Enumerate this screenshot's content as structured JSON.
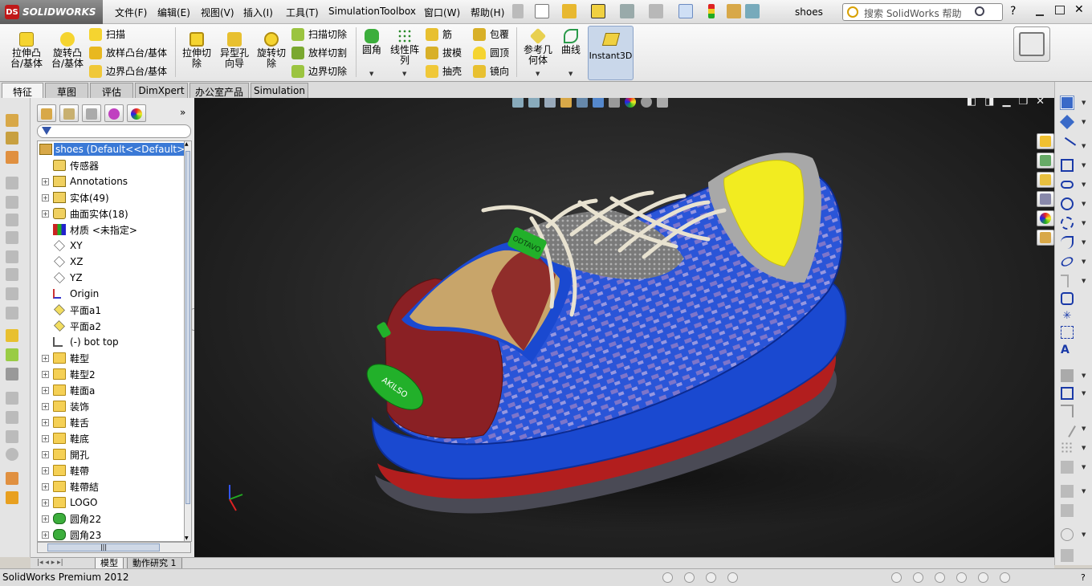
{
  "app": {
    "brand": "SOLIDWORKS",
    "filename": "shoes",
    "help_placeholder": "搜索 SolidWorks 帮助",
    "help_question": "?"
  },
  "menu": [
    "文件(F)",
    "编辑(E)",
    "视图(V)",
    "插入(I)",
    "工具(T)",
    "Simulation",
    "Toolbox",
    "窗口(W)",
    "帮助(H)"
  ],
  "commands": {
    "extrude_boss": "拉伸凸\n台/基体",
    "revolve_boss": "旋转凸\n台/基体",
    "sweep": "扫描",
    "loft_boss": "放样凸台/基体",
    "boundary_boss": "边界凸台/基体",
    "extrude_cut": "拉伸切\n除",
    "hole_wizard": "异型孔\n向导",
    "revolve_cut": "旋转切\n除",
    "sweep_cut": "扫描切除",
    "loft_cut": "放样切割",
    "boundary_cut": "边界切除",
    "fillet": "圆角",
    "linear_pattern": "线性阵\n列",
    "rib": "筋",
    "draft": "拔模",
    "shell": "抽壳",
    "wrap": "包覆",
    "dome": "圆顶",
    "mirror": "镜向",
    "ref_geometry": "参考几\n何体",
    "curves": "曲线",
    "instant3d": "Instant3D"
  },
  "tabs": [
    "特征",
    "草图",
    "评估",
    "DimXpert",
    "办公室产品",
    "Simulation"
  ],
  "tree": [
    {
      "label": "shoes  (Default<<Default>",
      "icon": "part-icon",
      "expand": false,
      "selected": true
    },
    {
      "label": "传感器",
      "icon": "sensor-icon",
      "expand": false
    },
    {
      "label": "Annotations",
      "icon": "annotations-icon",
      "expand": true
    },
    {
      "label": "实体(49)",
      "icon": "solid-bodies-icon",
      "expand": true
    },
    {
      "label": "曲面实体(18)",
      "icon": "surface-bodies-icon",
      "expand": true
    },
    {
      "label": "材质 <未指定>",
      "icon": "material-icon",
      "expand": false
    },
    {
      "label": "XY",
      "icon": "plane-icon",
      "expand": false
    },
    {
      "label": "XZ",
      "icon": "plane-icon",
      "expand": false
    },
    {
      "label": "YZ",
      "icon": "plane-icon",
      "expand": false
    },
    {
      "label": "Origin",
      "icon": "origin-icon",
      "expand": false
    },
    {
      "label": "平面a1",
      "icon": "plane-icon",
      "expand": false
    },
    {
      "label": "平面a2",
      "icon": "plane-icon",
      "expand": false
    },
    {
      "label": "(-) bot top",
      "icon": "sketch-icon",
      "expand": false
    },
    {
      "label": "鞋型",
      "icon": "folder-icon",
      "expand": true
    },
    {
      "label": "鞋型2",
      "icon": "folder-icon",
      "expand": true
    },
    {
      "label": "鞋面a",
      "icon": "folder-icon",
      "expand": true
    },
    {
      "label": "装饰",
      "icon": "folder-icon",
      "expand": true
    },
    {
      "label": "鞋舌",
      "icon": "folder-icon",
      "expand": true
    },
    {
      "label": "鞋底",
      "icon": "folder-icon",
      "expand": true
    },
    {
      "label": "開孔",
      "icon": "folder-icon",
      "expand": true
    },
    {
      "label": "鞋帶",
      "icon": "folder-icon",
      "expand": true
    },
    {
      "label": "鞋帶結",
      "icon": "folder-icon",
      "expand": true
    },
    {
      "label": "LOGO",
      "icon": "folder-icon",
      "expand": true
    },
    {
      "label": "圆角22",
      "icon": "fillet-icon",
      "expand": true
    },
    {
      "label": "圆角23",
      "icon": "fillet-icon",
      "expand": true
    }
  ],
  "model": {
    "badge_top": "ODTAVO",
    "badge_heel": "AKILSO"
  },
  "bottom_tabs": [
    "模型",
    "動作研究 1"
  ],
  "status": {
    "text": "SolidWorks Premium 2012"
  },
  "colors": {
    "accent": "#3a79d6",
    "shoe_blue": "#1c52d6",
    "toe_yellow": "#f2ec20",
    "logo_green": "#22b02a",
    "heel_red": "#8a2024"
  }
}
